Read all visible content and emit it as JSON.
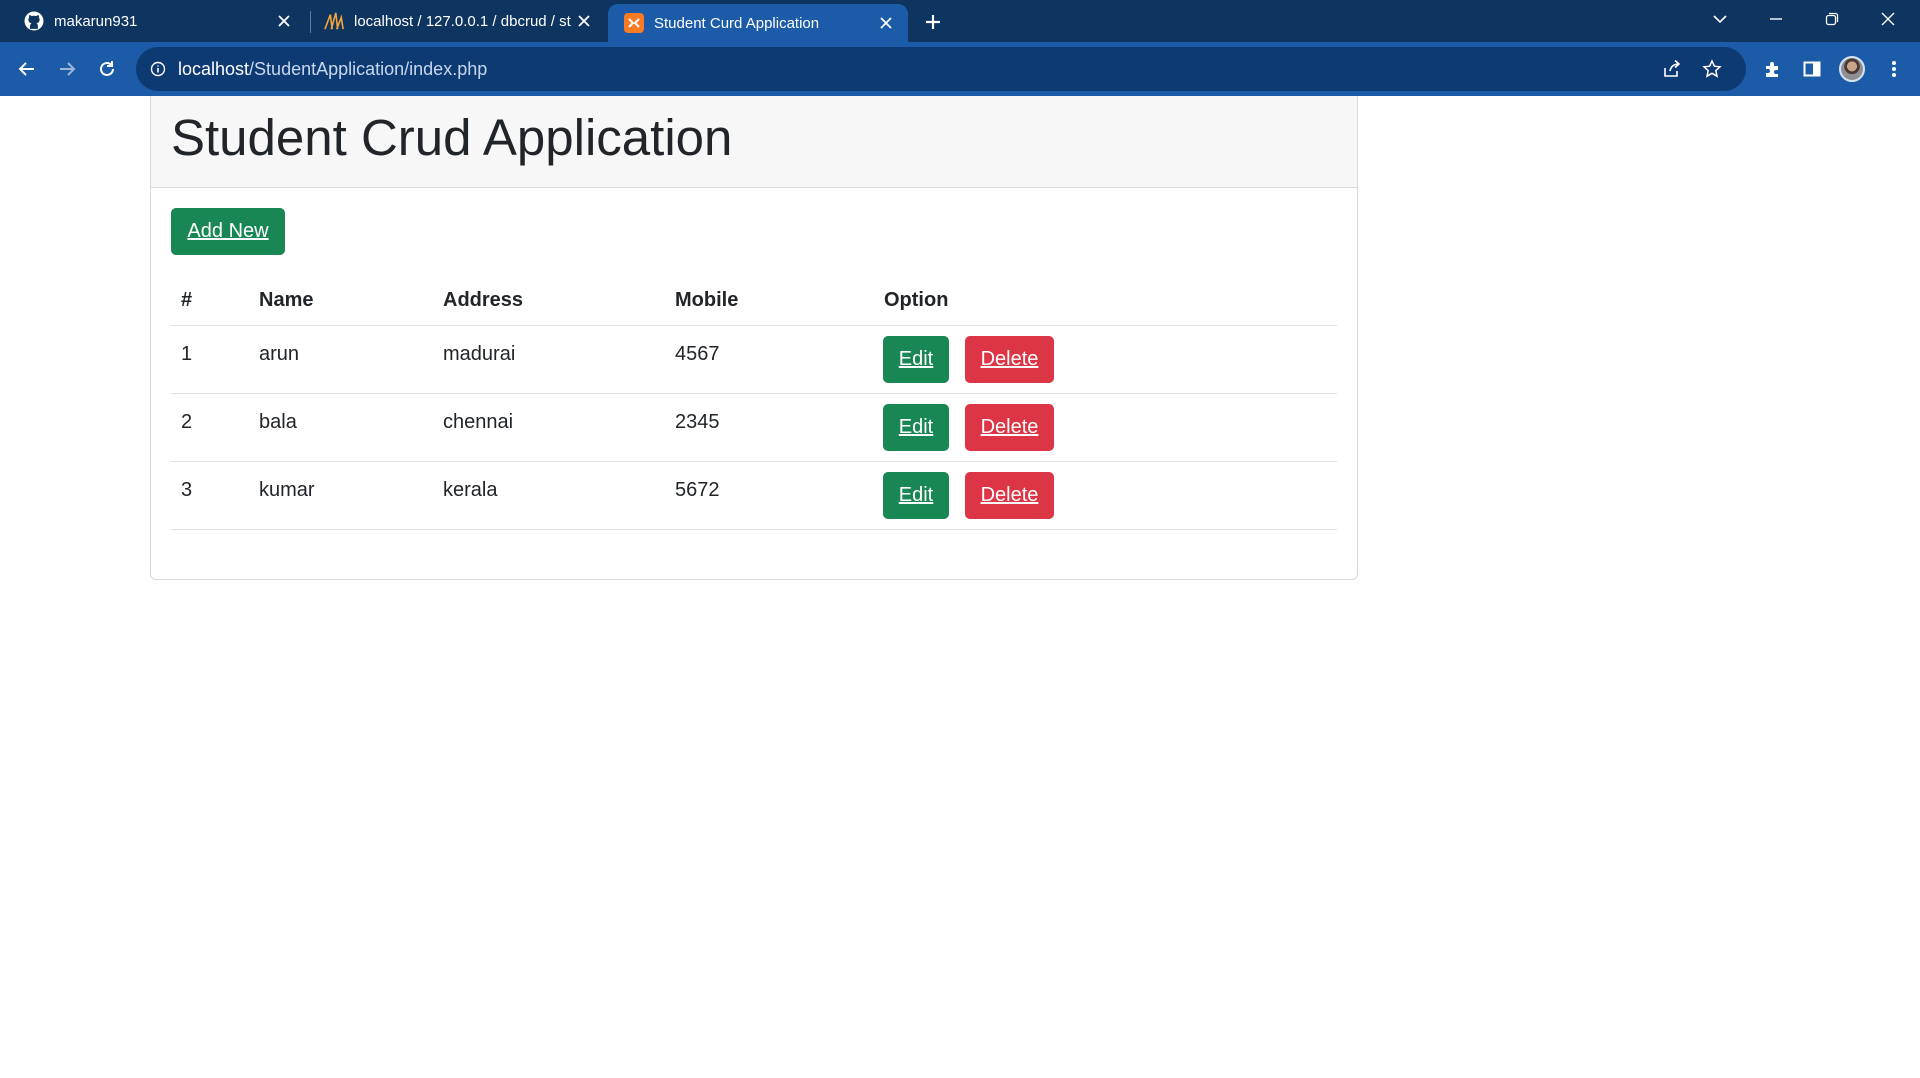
{
  "browser": {
    "tabs": [
      {
        "title": "makarun931",
        "favicon": "github-icon",
        "active": false
      },
      {
        "title": "localhost / 127.0.0.1 / dbcrud / st",
        "favicon": "phpmyadmin-icon",
        "active": false
      },
      {
        "title": "Student Curd Application",
        "favicon": "xampp-icon",
        "active": true
      }
    ],
    "address": {
      "host": "localhost",
      "path": "/StudentApplication/index.php"
    },
    "colors": {
      "tabbar": "#0e3460",
      "toolbar": "#1b5ba8",
      "omnibox": "#0d3a73"
    }
  },
  "page": {
    "title": "Student Crud Application",
    "add_button": "Add New",
    "columns": [
      "#",
      "Name",
      "Address",
      "Mobile",
      "Option"
    ],
    "rows": [
      {
        "id": "1",
        "name": "arun",
        "address": "madurai",
        "mobile": "4567"
      },
      {
        "id": "2",
        "name": "bala",
        "address": "chennai",
        "mobile": "2345"
      },
      {
        "id": "3",
        "name": "kumar",
        "address": "kerala",
        "mobile": "5672"
      }
    ],
    "edit_label": "Edit",
    "delete_label": "Delete",
    "colors": {
      "success": "#198754",
      "danger": "#dc3545"
    }
  }
}
